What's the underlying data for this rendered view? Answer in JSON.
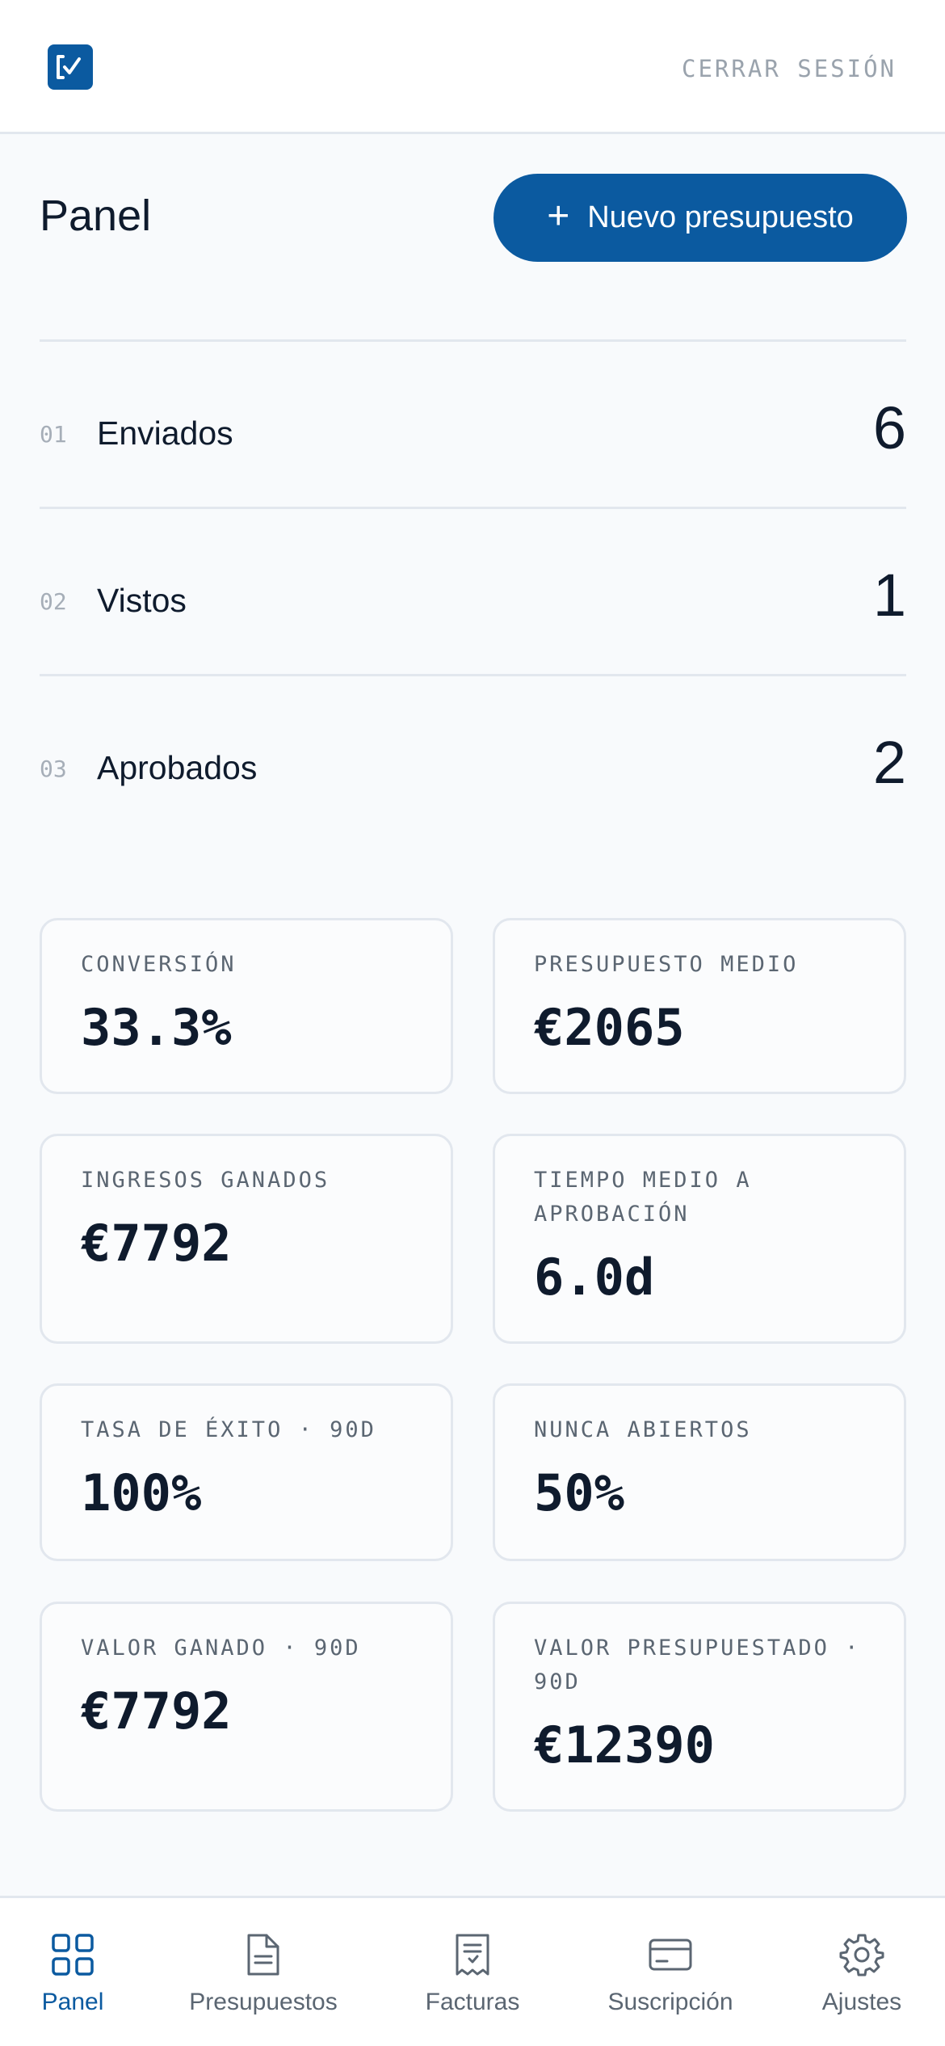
{
  "topbar": {
    "logout_label": "CERRAR SESIÓN"
  },
  "header": {
    "title": "Panel",
    "new_button_label": "Nuevo presupuesto"
  },
  "stats": [
    {
      "num": "01",
      "label": "Enviados",
      "value": "6"
    },
    {
      "num": "02",
      "label": "Vistos",
      "value": "1"
    },
    {
      "num": "03",
      "label": "Aprobados",
      "value": "2"
    }
  ],
  "metrics": [
    {
      "label": "CONVERSIÓN",
      "value": "33.3%"
    },
    {
      "label": "PRESUPUESTO MEDIO",
      "value": "€2065"
    },
    {
      "label": "INGRESOS GANADOS",
      "value": "€7792"
    },
    {
      "label": "TIEMPO MEDIO A APROBACIÓN",
      "value": "6.0d"
    },
    {
      "label": "TASA DE ÉXITO · 90D",
      "value": "100%"
    },
    {
      "label": "NUNCA ABIERTOS",
      "value": "50%"
    },
    {
      "label": "VALOR GANADO · 90D",
      "value": "€7792"
    },
    {
      "label": "VALOR PRESUPUESTADO · 90D",
      "value": "€12390"
    }
  ],
  "nav": [
    {
      "label": "Panel",
      "icon": "grid-icon",
      "active": true
    },
    {
      "label": "Presupuestos",
      "icon": "document-icon"
    },
    {
      "label": "Facturas",
      "icon": "receipt-icon"
    },
    {
      "label": "Suscripción",
      "icon": "credit-card-icon"
    },
    {
      "label": "Ajustes",
      "icon": "gear-icon"
    }
  ],
  "colors": {
    "brand": "#0b5aa0",
    "background": "#f8fafc",
    "text": "#0f1b2d",
    "muted": "#5b6672",
    "border": "#e2e7ee"
  }
}
